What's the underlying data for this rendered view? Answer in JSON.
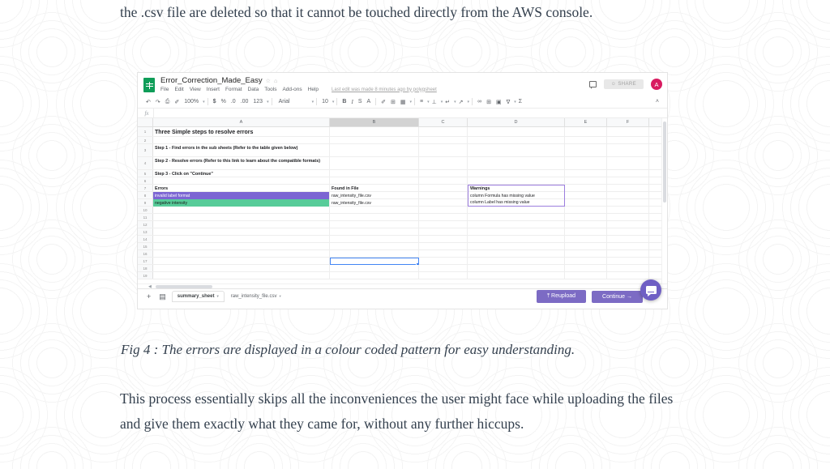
{
  "article": {
    "paragraph_top": "the .csv file are deleted so that it cannot be touched directly from the AWS console.",
    "caption": "Fig 4 : The errors are displayed in a colour coded pattern for easy understanding.",
    "paragraph_bottom": "This process essentially skips all the inconveniences the user might face while uploading the files and give them exactly what they came for, without any further hiccups."
  },
  "sheets": {
    "doc_title": "Error_Correction_Made_Easy",
    "star_icon": "☆",
    "drive_icon": "⌂",
    "menu": [
      "File",
      "Edit",
      "View",
      "Insert",
      "Format",
      "Data",
      "Tools",
      "Add-ons",
      "Help"
    ],
    "last_edit": "Last edit was made 8 minutes ago by polygsheet",
    "share_label": "SHARE",
    "share_icon": "☺",
    "avatar_initial": "A",
    "toolbar": {
      "undo": "↶",
      "redo": "↷",
      "print": "⎙",
      "paint": "✐",
      "zoom": "100%",
      "currency": "$",
      "percent": "%",
      "dec_less": ".0",
      "dec_more": ".00",
      "formats": "123",
      "font": "Arial",
      "font_size": "10",
      "bold": "B",
      "italic": "I",
      "strike": "S",
      "text_color": "A",
      "fill_color": "✐",
      "borders": "⊞",
      "merge": "▦",
      "halign": "≡",
      "valign": "⊥",
      "wrap": "↵",
      "rotate": "↗",
      "link": "∞",
      "comment": "⊞",
      "chart": "▣",
      "filter": "∇",
      "functions": "Σ",
      "collapse": "˄"
    },
    "formula_bar": {
      "fx": "fx",
      "value": ""
    },
    "grid": {
      "columns": [
        "A",
        "B",
        "C",
        "D",
        "E",
        "F"
      ],
      "selected_column": "B",
      "rows": [
        {
          "n": "1",
          "h": 12,
          "cells": [
            {
              "t": "Three Simple steps to resolve errors",
              "cls": "title"
            },
            {
              "t": ""
            },
            {
              "t": ""
            },
            {
              "t": ""
            },
            {
              "t": ""
            },
            {
              "t": ""
            }
          ]
        },
        {
          "n": "2",
          "h": 9,
          "cells": [
            {
              "t": ""
            },
            {
              "t": ""
            },
            {
              "t": ""
            },
            {
              "t": ""
            },
            {
              "t": ""
            },
            {
              "t": ""
            }
          ]
        },
        {
          "n": "3",
          "h": 16,
          "cells": [
            {
              "t": "Step 1 - Find errors in the sub sheets (Refer to the table given below)",
              "cls": "b wrap"
            },
            {
              "t": ""
            },
            {
              "t": ""
            },
            {
              "t": ""
            },
            {
              "t": ""
            },
            {
              "t": ""
            }
          ]
        },
        {
          "n": "4",
          "h": 16,
          "cells": [
            {
              "t": "Step 2 - Resolve errors (Refer to this link to learn about the compatible formats)",
              "cls": "b wrap"
            },
            {
              "t": ""
            },
            {
              "t": ""
            },
            {
              "t": ""
            },
            {
              "t": ""
            },
            {
              "t": ""
            }
          ]
        },
        {
          "n": "5",
          "h": 9,
          "cells": [
            {
              "t": "Step 3 - Click on \"Continue\"",
              "cls": "b"
            },
            {
              "t": ""
            },
            {
              "t": ""
            },
            {
              "t": ""
            },
            {
              "t": ""
            },
            {
              "t": ""
            }
          ]
        },
        {
          "n": "6",
          "h": 9,
          "cells": [
            {
              "t": ""
            },
            {
              "t": ""
            },
            {
              "t": ""
            },
            {
              "t": ""
            },
            {
              "t": ""
            },
            {
              "t": ""
            }
          ]
        },
        {
          "n": "7",
          "h": 9,
          "cells": [
            {
              "t": "Errors",
              "cls": "b"
            },
            {
              "t": "Found in File",
              "cls": "b"
            },
            {
              "t": ""
            },
            {
              "t": "Warnings",
              "cls": "b warn-box top"
            },
            {
              "t": ""
            },
            {
              "t": ""
            }
          ]
        },
        {
          "n": "8",
          "h": 9,
          "cells": [
            {
              "t": "invalid label format",
              "cls": "fill-purple"
            },
            {
              "t": "raw_intensity_file.csv"
            },
            {
              "t": ""
            },
            {
              "t": "column Formula has missing value",
              "cls": "warn-box mid"
            },
            {
              "t": ""
            },
            {
              "t": ""
            }
          ]
        },
        {
          "n": "9",
          "h": 9,
          "cells": [
            {
              "t": "negative intensity",
              "cls": "fill-green"
            },
            {
              "t": "raw_intensity_file.csv"
            },
            {
              "t": ""
            },
            {
              "t": "column Label has missing value",
              "cls": "warn-box bot"
            },
            {
              "t": ""
            },
            {
              "t": ""
            }
          ]
        },
        {
          "n": "10",
          "h": 9,
          "cells": [
            {
              "t": ""
            },
            {
              "t": ""
            },
            {
              "t": ""
            },
            {
              "t": ""
            },
            {
              "t": ""
            },
            {
              "t": ""
            }
          ]
        },
        {
          "n": "11",
          "h": 9,
          "cells": [
            {
              "t": ""
            },
            {
              "t": ""
            },
            {
              "t": ""
            },
            {
              "t": ""
            },
            {
              "t": ""
            },
            {
              "t": ""
            }
          ]
        },
        {
          "n": "12",
          "h": 9,
          "cells": [
            {
              "t": ""
            },
            {
              "t": ""
            },
            {
              "t": ""
            },
            {
              "t": ""
            },
            {
              "t": ""
            },
            {
              "t": ""
            }
          ]
        },
        {
          "n": "13",
          "h": 9,
          "cells": [
            {
              "t": ""
            },
            {
              "t": ""
            },
            {
              "t": ""
            },
            {
              "t": ""
            },
            {
              "t": ""
            },
            {
              "t": ""
            }
          ]
        },
        {
          "n": "14",
          "h": 9,
          "cells": [
            {
              "t": ""
            },
            {
              "t": ""
            },
            {
              "t": ""
            },
            {
              "t": ""
            },
            {
              "t": ""
            },
            {
              "t": ""
            }
          ]
        },
        {
          "n": "15",
          "h": 9,
          "cells": [
            {
              "t": ""
            },
            {
              "t": ""
            },
            {
              "t": ""
            },
            {
              "t": ""
            },
            {
              "t": ""
            },
            {
              "t": ""
            }
          ]
        },
        {
          "n": "16",
          "h": 9,
          "cells": [
            {
              "t": ""
            },
            {
              "t": ""
            },
            {
              "t": ""
            },
            {
              "t": ""
            },
            {
              "t": ""
            },
            {
              "t": ""
            }
          ]
        },
        {
          "n": "17",
          "h": 9,
          "cells": [
            {
              "t": ""
            },
            {
              "t": "",
              "cls": "selected"
            },
            {
              "t": ""
            },
            {
              "t": ""
            },
            {
              "t": ""
            },
            {
              "t": ""
            }
          ]
        },
        {
          "n": "18",
          "h": 9,
          "cells": [
            {
              "t": ""
            },
            {
              "t": ""
            },
            {
              "t": ""
            },
            {
              "t": ""
            },
            {
              "t": ""
            },
            {
              "t": ""
            }
          ]
        },
        {
          "n": "19",
          "h": 9,
          "cells": [
            {
              "t": ""
            },
            {
              "t": ""
            },
            {
              "t": ""
            },
            {
              "t": ""
            },
            {
              "t": ""
            },
            {
              "t": ""
            }
          ]
        }
      ]
    },
    "footer": {
      "add_sheet_icon": "+",
      "all_sheets_icon": "▤",
      "tabs": [
        {
          "label": "summary_sheet",
          "active": true
        },
        {
          "label": "raw_intensity_file.csv",
          "active": false
        }
      ],
      "reupload_label": "⤒ Reupload",
      "continue_label": "Continue →"
    },
    "colors": {
      "error_invalid_label": "#7c65d3",
      "error_negative_intensity": "#57cc99",
      "warning_border": "#9c7ede",
      "action_button": "#7c6bc4",
      "avatar": "#d81b60",
      "sheets_green": "#0f9d58",
      "selection_blue": "#4285f4"
    }
  }
}
